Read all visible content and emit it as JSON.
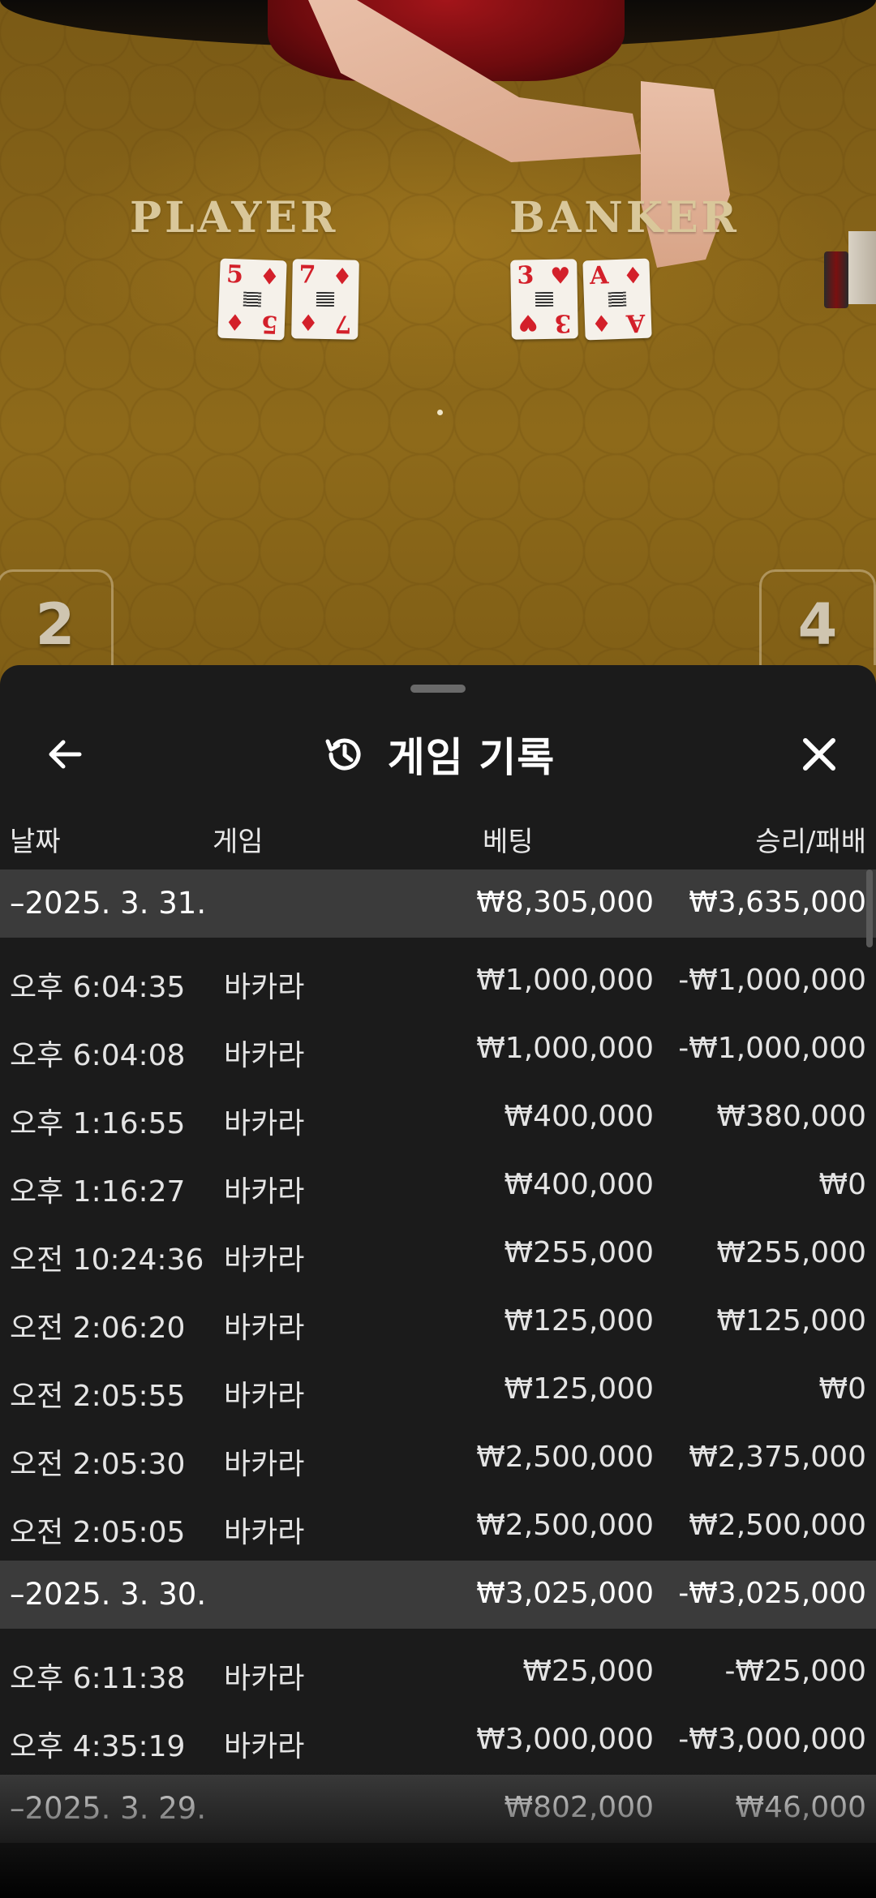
{
  "video": {
    "player_label": "PLAYER",
    "banker_label": "BANKER",
    "player_cards": [
      {
        "rank": "5",
        "suit": "♦"
      },
      {
        "rank": "7",
        "suit": "♦"
      }
    ],
    "banker_cards": [
      {
        "rank": "3",
        "suit": "♥"
      },
      {
        "rank": "A",
        "suit": "♦"
      }
    ],
    "box_left_number": "2",
    "box_right_number": "4"
  },
  "header": {
    "title": "게임 기록",
    "back_icon": "arrow-left-icon",
    "history_icon": "history-icon",
    "close_icon": "close-icon"
  },
  "columns": {
    "date": "날짜",
    "game": "게임",
    "bet": "베팅",
    "result": "승리/패배"
  },
  "groups": [
    {
      "date": "–2025. 3. 31.",
      "bet": "₩8,305,000",
      "result": "₩3,635,000",
      "items": [
        {
          "time": "오후 6:04:35",
          "game": "바카라",
          "bet": "₩1,000,000",
          "result": "-₩1,000,000"
        },
        {
          "time": "오후 6:04:08",
          "game": "바카라",
          "bet": "₩1,000,000",
          "result": "-₩1,000,000"
        },
        {
          "time": "오후 1:16:55",
          "game": "바카라",
          "bet": "₩400,000",
          "result": "₩380,000"
        },
        {
          "time": "오후 1:16:27",
          "game": "바카라",
          "bet": "₩400,000",
          "result": "₩0"
        },
        {
          "time": "오전 10:24:36",
          "game": "바카라",
          "bet": "₩255,000",
          "result": "₩255,000"
        },
        {
          "time": "오전 2:06:20",
          "game": "바카라",
          "bet": "₩125,000",
          "result": "₩125,000"
        },
        {
          "time": "오전 2:05:55",
          "game": "바카라",
          "bet": "₩125,000",
          "result": "₩0"
        },
        {
          "time": "오전 2:05:30",
          "game": "바카라",
          "bet": "₩2,500,000",
          "result": "₩2,375,000"
        },
        {
          "time": "오전 2:05:05",
          "game": "바카라",
          "bet": "₩2,500,000",
          "result": "₩2,500,000"
        }
      ]
    },
    {
      "date": "–2025. 3. 30.",
      "bet": "₩3,025,000",
      "result": "-₩3,025,000",
      "items": [
        {
          "time": "오후 6:11:38",
          "game": "바카라",
          "bet": "₩25,000",
          "result": "-₩25,000"
        },
        {
          "time": "오후 4:35:19",
          "game": "바카라",
          "bet": "₩3,000,000",
          "result": "-₩3,000,000"
        }
      ]
    },
    {
      "date": "–2025. 3. 29.",
      "bet": "₩802,000",
      "result": "₩46,000",
      "items": []
    }
  ],
  "colors": {
    "sheet_bg": "#1b1b1b",
    "group_bg": "#3b3b3b",
    "text": "#ffffff",
    "table_felt": "#8a6718",
    "card_red": "#d3202a"
  }
}
